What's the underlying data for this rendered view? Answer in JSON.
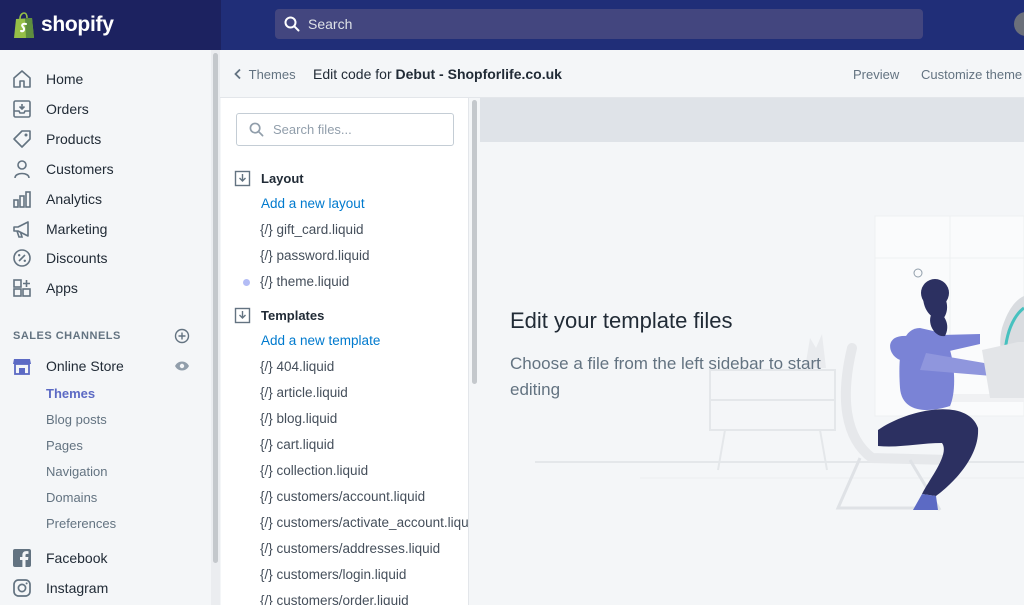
{
  "brand": {
    "name": "shopify"
  },
  "search": {
    "placeholder": "Search"
  },
  "nav": {
    "items": [
      {
        "label": "Home",
        "icon": "home-icon"
      },
      {
        "label": "Orders",
        "icon": "orders-icon"
      },
      {
        "label": "Products",
        "icon": "tag-icon"
      },
      {
        "label": "Customers",
        "icon": "person-icon"
      },
      {
        "label": "Analytics",
        "icon": "bar-chart-icon"
      },
      {
        "label": "Marketing",
        "icon": "megaphone-icon"
      },
      {
        "label": "Discounts",
        "icon": "discount-icon"
      },
      {
        "label": "Apps",
        "icon": "apps-icon"
      }
    ],
    "sales_channels_title": "SALES CHANNELS",
    "online_store": "Online Store",
    "sub_items": [
      "Themes",
      "Blog posts",
      "Pages",
      "Navigation",
      "Domains",
      "Preferences"
    ],
    "active_sub": "Themes",
    "channels": [
      "Facebook",
      "Instagram"
    ]
  },
  "header": {
    "back": "Themes",
    "title_prefix": "Edit code for ",
    "title_bold": "Debut - Shopforlife.co.uk",
    "preview": "Preview",
    "customize": "Customize theme"
  },
  "files": {
    "search_placeholder": "Search files...",
    "layout": {
      "label": "Layout",
      "add": "Add a new layout",
      "items": [
        "{/} gift_card.liquid",
        "{/} password.liquid",
        "{/} theme.liquid"
      ]
    },
    "templates": {
      "label": "Templates",
      "add": "Add a new template",
      "items": [
        "{/} 404.liquid",
        "{/} article.liquid",
        "{/} blog.liquid",
        "{/} cart.liquid",
        "{/} collection.liquid",
        "{/} customers/account.liquid",
        "{/} customers/activate_account.liquid",
        "{/} customers/addresses.liquid",
        "{/} customers/login.liquid",
        "{/} customers/order.liquid"
      ]
    }
  },
  "editor": {
    "title": "Edit your template files",
    "subtitle": "Choose a file from the left sidebar to start editing"
  },
  "colors": {
    "topbar": "#1c2260",
    "search_bg": "#43467f",
    "accent": "#5c6ac4",
    "link": "#007ace"
  }
}
